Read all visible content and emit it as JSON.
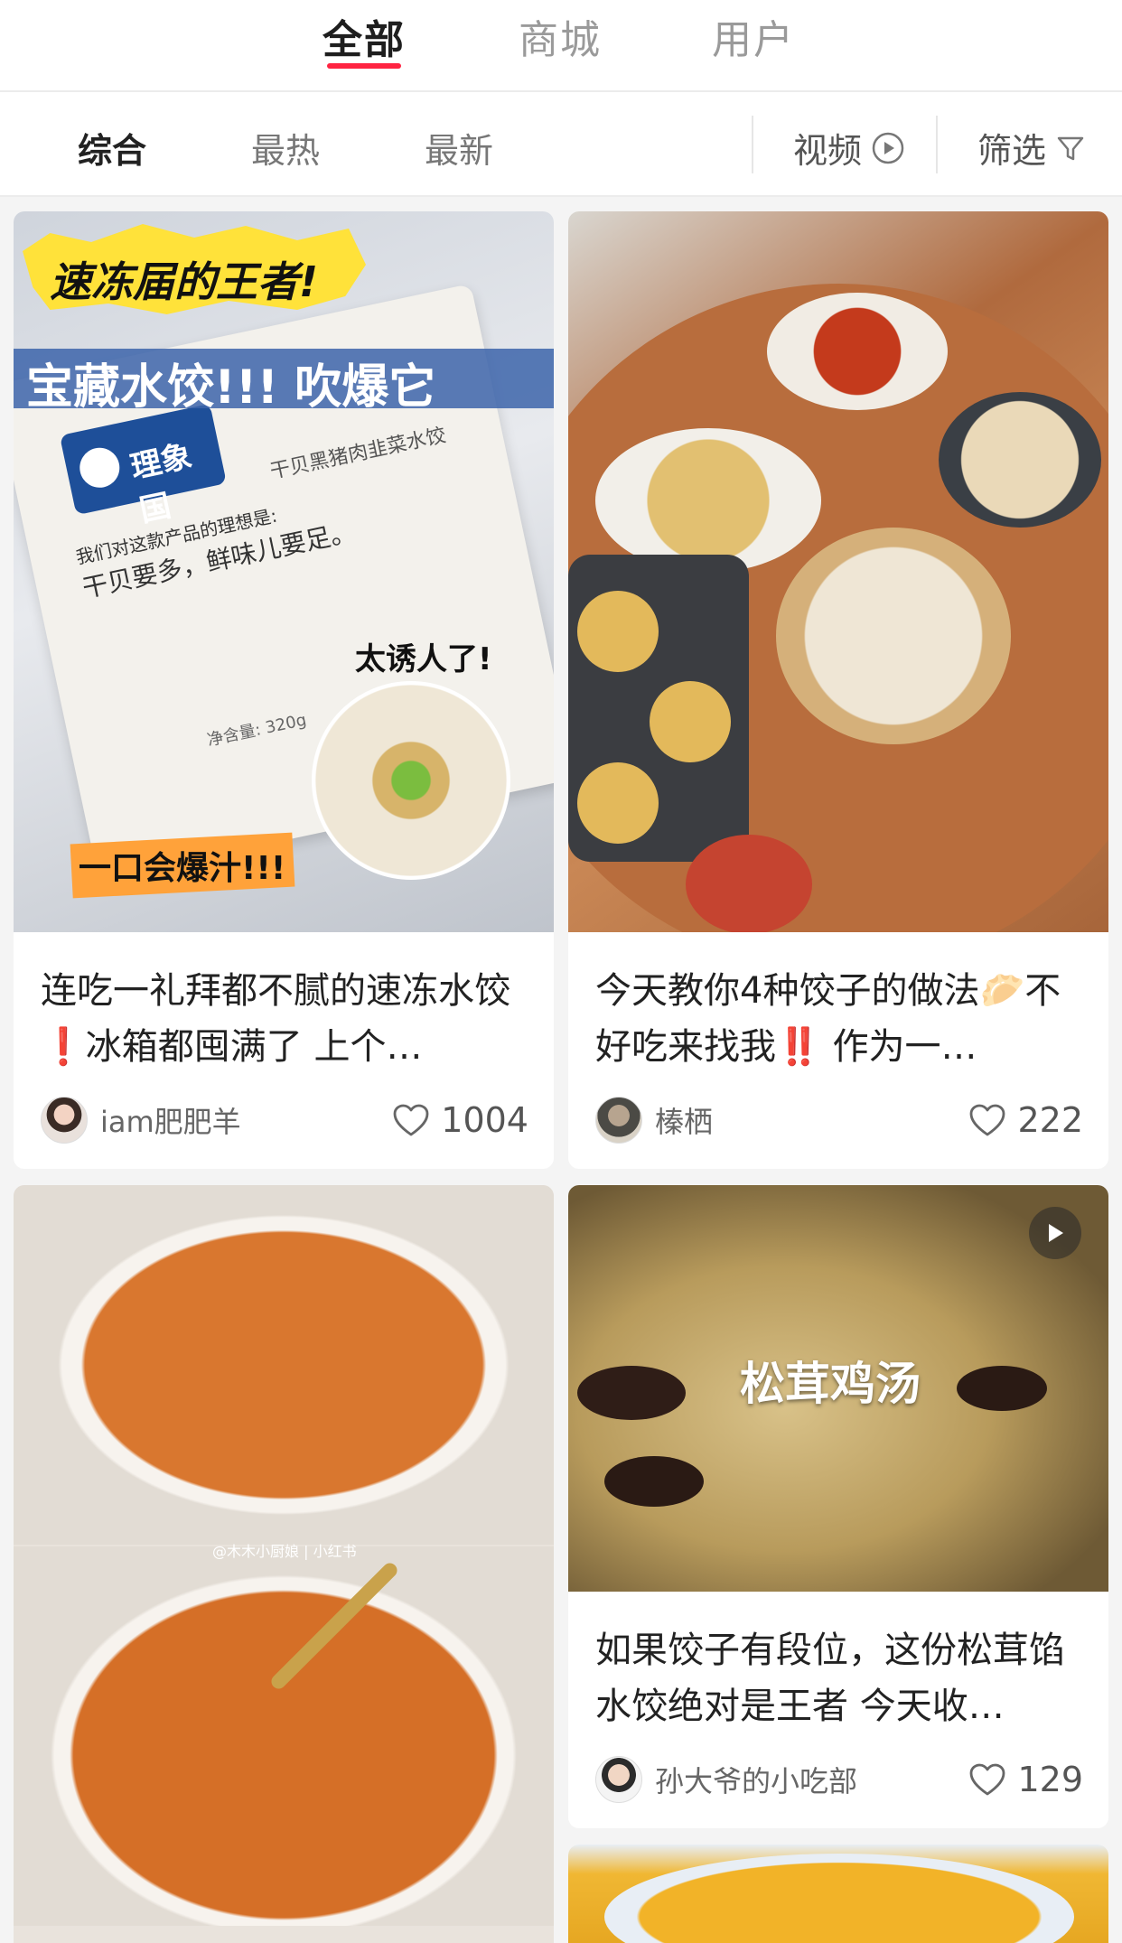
{
  "top_tabs": [
    "全部",
    "商城",
    "用户"
  ],
  "sort_bar": {
    "items": [
      "综合",
      "最热",
      "最新"
    ],
    "video_label": "视频",
    "filter_label": "筛选"
  },
  "posts": [
    {
      "image_text": {
        "banner": "速冻届的王者!",
        "headline": "宝藏水饺!!! 吹爆它",
        "brand": "理象国",
        "pack_line1": "我们对这款产品的理想是:",
        "pack_line2": "干贝要多，鲜味儿要足。",
        "pack_line3": "干贝黑猪肉韭菜水饺",
        "tag": "太诱人了!",
        "bottom": "一口会爆汁!!!",
        "net_weight": "净含量: 320g"
      },
      "title": "连吃一礼拜都不腻的速冻水饺❗冰箱都囤满了 上个…",
      "author": "iam肥肥羊",
      "likes": "1004"
    },
    {
      "title": "今天教你4种饺子的做法🥟不好吃来找我‼️ 作为一…",
      "author": "榛栖",
      "likes": "222"
    },
    {
      "image_text": {
        "watermark": "@木木小厨娘 | 小红书"
      },
      "title": "",
      "author": "",
      "likes": ""
    },
    {
      "image_text": {
        "caption": "松茸鸡汤"
      },
      "is_video": true,
      "title": "如果饺子有段位，这份松茸馅水饺绝对是王者 今天收…",
      "author": "孙大爷的小吃部",
      "likes": "129"
    }
  ],
  "colors": {
    "accent": "#ff2442"
  }
}
